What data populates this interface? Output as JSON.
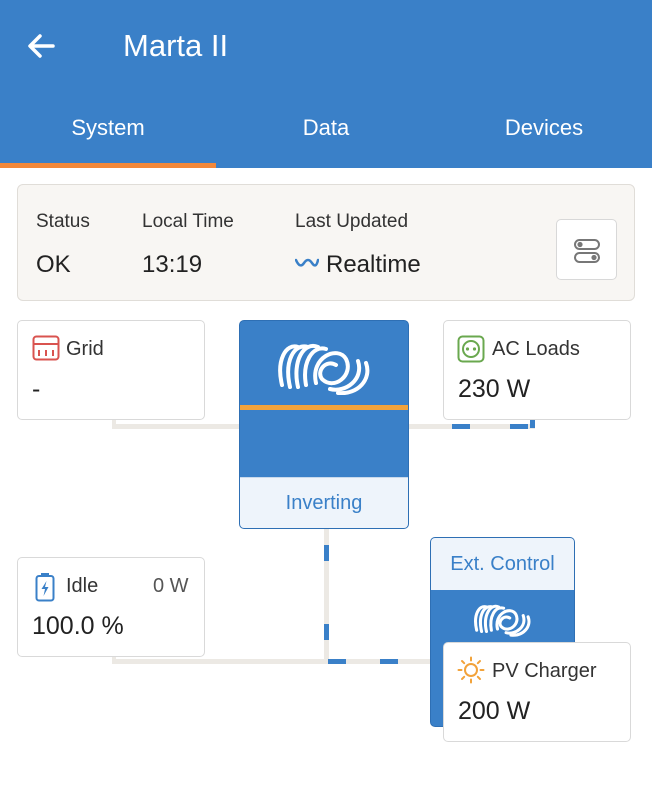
{
  "header": {
    "title": "Marta II",
    "back_icon": "arrow-left-icon"
  },
  "tabs": [
    {
      "label": "System",
      "active": true
    },
    {
      "label": "Data",
      "active": false
    },
    {
      "label": "Devices",
      "active": false
    }
  ],
  "status": {
    "status_label": "Status",
    "status_value": "OK",
    "time_label": "Local Time",
    "time_value": "13:19",
    "updated_label": "Last Updated",
    "updated_value": "Realtime"
  },
  "grid": {
    "label": "Grid",
    "value": "-"
  },
  "ac_loads": {
    "label": "AC Loads",
    "value": "230 W"
  },
  "inverter": {
    "state": "Inverting"
  },
  "battery": {
    "label": "Idle",
    "power": "0 W",
    "value": "100.0 %"
  },
  "ext_control": {
    "label": "Ext. Control"
  },
  "pv_charger": {
    "label": "PV Charger",
    "value": "200 W"
  },
  "colors": {
    "brand_blue": "#3a80c8",
    "accent_orange": "#f2883a",
    "grid_red": "#d9534f",
    "acload_green": "#6aa84f",
    "battery_blue": "#3a80c8",
    "pv_orange": "#f2a23a"
  }
}
